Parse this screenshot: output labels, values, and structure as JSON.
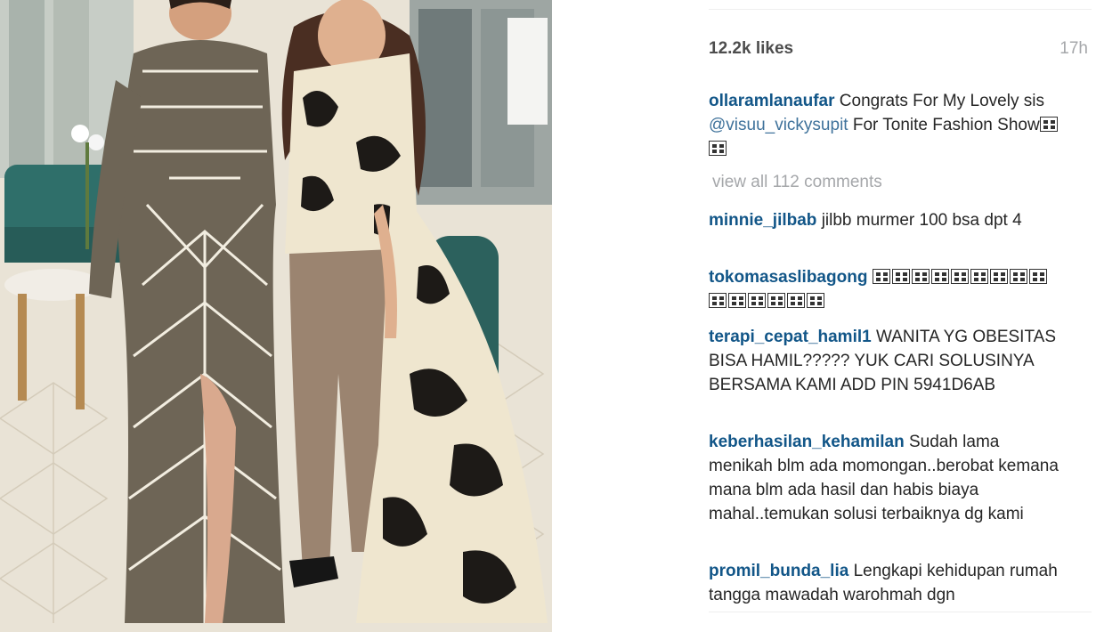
{
  "post": {
    "likes": "12.2k likes",
    "time_ago": "17h",
    "caption": {
      "username": "ollaramlanaufar",
      "text_before": " Congrats For My Lovely sis ",
      "mention": "@visuu_vickysupit",
      "text_after": " For Tonite Fashion Show",
      "emoji_count": 2
    },
    "view_all_comments": "view all 112 comments",
    "comments": [
      {
        "username": "minnie_jilbab",
        "text": " jilbb murmer 100 bsa dpt 4"
      },
      {
        "username": "tokomasaslibagong",
        "text": " "
      },
      {
        "username": "terapi_cepat_hamil1",
        "text": " WANITA YG OBESITAS BISA HAMIL????? YUK CARI SOLUSINYA BERSAMA KAMI ADD PIN 5941D6AB"
      },
      {
        "username": "keberhasilan_kehamilan",
        "text": " Sudah lama menikah blm ada momongan..berobat kemana mana blm ada hasil dan habis biaya mahal..temukan solusi terbaiknya dg kami"
      },
      {
        "username": "promil_bunda_lia",
        "text": " Lengkapi kehidupan rumah tangga mawadah warohmah dgn"
      }
    ]
  },
  "colors": {
    "username": "#125688",
    "mention": "#3f729b",
    "muted": "#a5a7aa",
    "text": "#262626"
  }
}
